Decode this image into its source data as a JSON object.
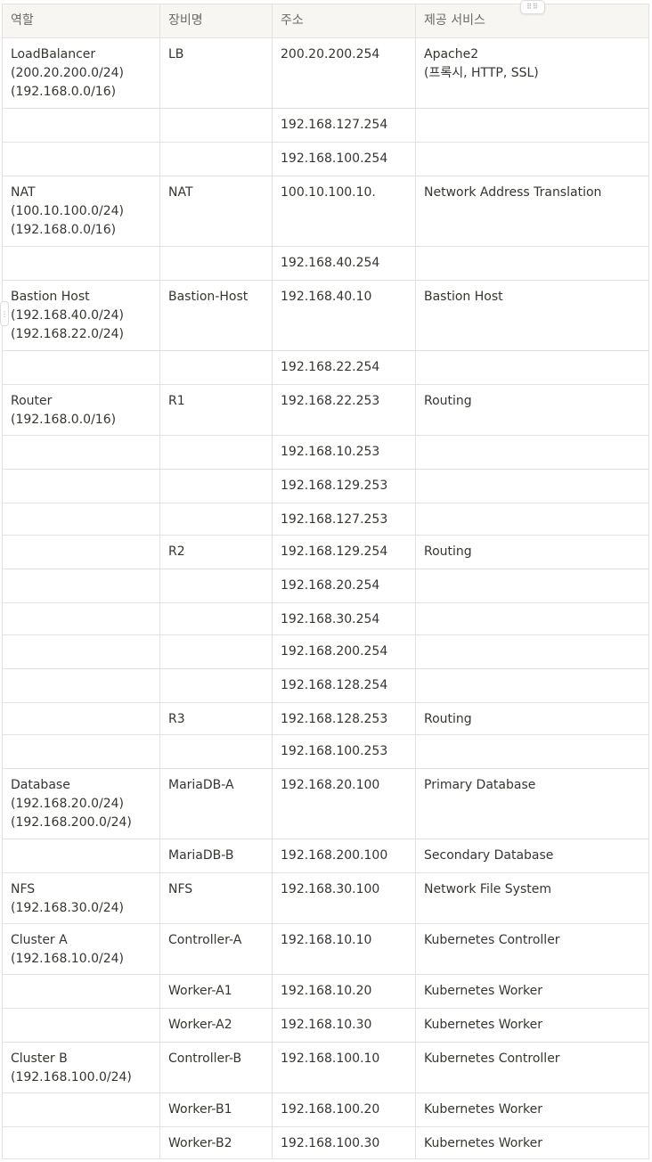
{
  "table": {
    "headers": [
      "역할",
      "장비명",
      "주소",
      "제공 서비스"
    ],
    "rows": [
      {
        "role": "LoadBalancer\n(200.20.200.0/24)\n(192.168.0.0/16)",
        "device": "LB",
        "address": "200.20.200.254",
        "service": "Apache2\n(프록시, HTTP, SSL)"
      },
      {
        "role": "",
        "device": "",
        "address": "192.168.127.254",
        "service": ""
      },
      {
        "role": "",
        "device": "",
        "address": "192.168.100.254",
        "service": ""
      },
      {
        "role": "NAT\n(100.10.100.0/24)\n(192.168.0.0/16)",
        "device": "NAT",
        "address": "100.10.100.10.",
        "service": "Network Address Translation"
      },
      {
        "role": "",
        "device": "",
        "address": "192.168.40.254",
        "service": ""
      },
      {
        "role": "Bastion Host\n(192.168.40.0/24)\n(192.168.22.0/24)",
        "device": "Bastion-Host",
        "address": "192.168.40.10",
        "service": "Bastion Host"
      },
      {
        "role": "",
        "device": "",
        "address": "192.168.22.254",
        "service": ""
      },
      {
        "role": "Router\n(192.168.0.0/16)",
        "device": "R1",
        "address": "192.168.22.253",
        "service": "Routing"
      },
      {
        "role": "",
        "device": "",
        "address": "192.168.10.253",
        "service": ""
      },
      {
        "role": "",
        "device": "",
        "address": "192.168.129.253",
        "service": ""
      },
      {
        "role": "",
        "device": "",
        "address": "192.168.127.253",
        "service": ""
      },
      {
        "role": "",
        "device": "R2",
        "address": "192.168.129.254",
        "service": "Routing"
      },
      {
        "role": "",
        "device": "",
        "address": "192.168.20.254",
        "service": ""
      },
      {
        "role": "",
        "device": "",
        "address": "192.168.30.254",
        "service": ""
      },
      {
        "role": "",
        "device": "",
        "address": "192.168.200.254",
        "service": ""
      },
      {
        "role": "",
        "device": "",
        "address": "192.168.128.254",
        "service": ""
      },
      {
        "role": "",
        "device": "R3",
        "address": "192.168.128.253",
        "service": "Routing"
      },
      {
        "role": "",
        "device": "",
        "address": "192.168.100.253",
        "service": ""
      },
      {
        "role": "Database\n(192.168.20.0/24)\n(192.168.200.0/24)",
        "device": "MariaDB-A",
        "address": "192.168.20.100",
        "service": "Primary Database"
      },
      {
        "role": "",
        "device": "MariaDB-B",
        "address": "192.168.200.100",
        "service": "Secondary Database"
      },
      {
        "role": "NFS\n(192.168.30.0/24)",
        "device": "NFS",
        "address": "192.168.30.100",
        "service": "Network File System"
      },
      {
        "role": "Cluster A\n(192.168.10.0/24)",
        "device": "Controller-A",
        "address": "192.168.10.10",
        "service": "Kubernetes Controller"
      },
      {
        "role": "",
        "device": "Worker-A1",
        "address": "192.168.10.20",
        "service": "Kubernetes Worker"
      },
      {
        "role": "",
        "device": "Worker-A2",
        "address": "192.168.10.30",
        "service": "Kubernetes Worker"
      },
      {
        "role": "Cluster B\n(192.168.100.0/24)",
        "device": "Controller-B",
        "address": "192.168.100.10",
        "service": "Kubernetes Controller"
      },
      {
        "role": "",
        "device": "Worker-B1",
        "address": "192.168.100.20",
        "service": "Kubernetes Worker"
      },
      {
        "role": "",
        "device": "Worker-B2",
        "address": "192.168.100.30",
        "service": "Kubernetes Worker"
      }
    ]
  },
  "icons": {
    "column_drag_handle": "drag-handle-icon",
    "row_drag_handle": "drag-handle-icon"
  },
  "colors": {
    "header_bg": "#f7f6f3",
    "border": "#e3e2de",
    "text": "#37352f"
  }
}
